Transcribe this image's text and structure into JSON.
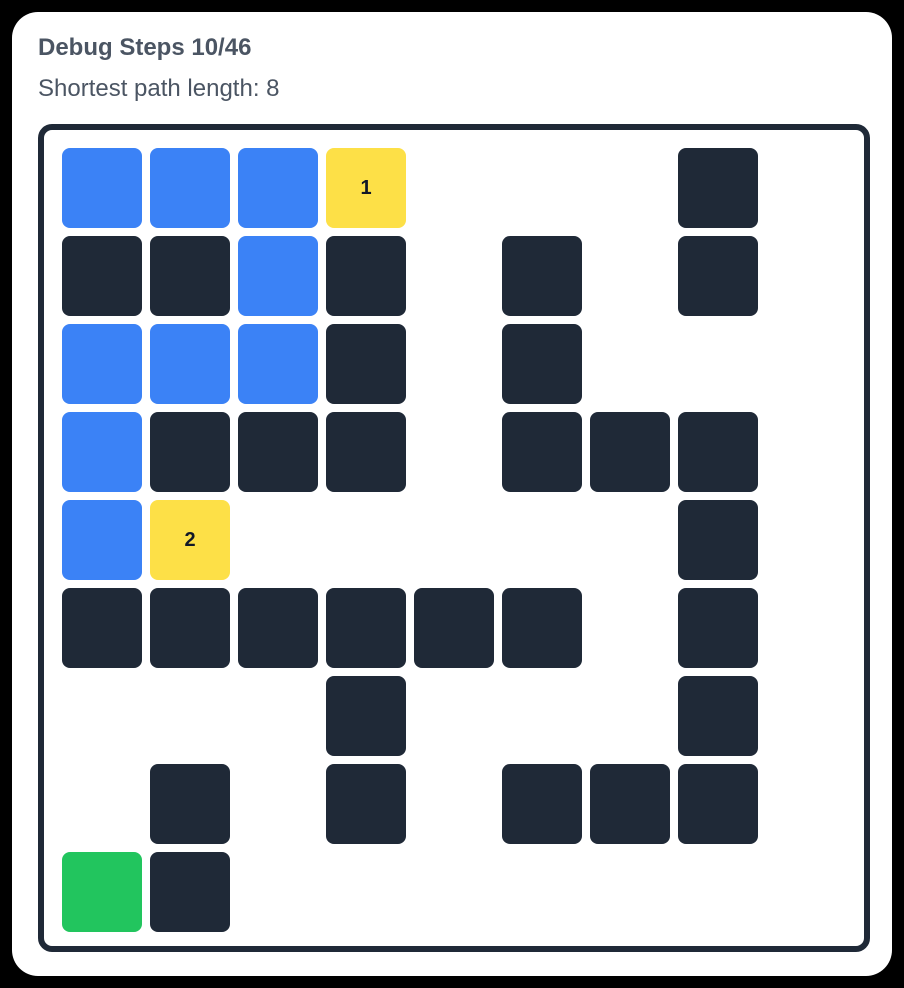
{
  "header": {
    "title": "Debug Steps 10/46",
    "subtitle": "Shortest path length: 8"
  },
  "colors": {
    "wall": "#1f2937",
    "visited": "#3b82f6",
    "waypoint": "#fde047",
    "goal": "#22c55e",
    "empty": "#ffffff",
    "border": "#1f2937"
  },
  "grid": {
    "rows": 9,
    "cols": 9,
    "legend": {
      "W": "wall",
      "V": "visited",
      "G": "goal",
      "Y": "waypoint",
      ".": "empty"
    },
    "cells": [
      [
        "V",
        "V",
        "V",
        "Y",
        ".",
        ".",
        ".",
        "W",
        "."
      ],
      [
        "W",
        "W",
        "V",
        "W",
        ".",
        "W",
        ".",
        "W",
        "."
      ],
      [
        "V",
        "V",
        "V",
        "W",
        ".",
        "W",
        ".",
        ".",
        "."
      ],
      [
        "V",
        "W",
        "W",
        "W",
        ".",
        "W",
        "W",
        "W",
        "."
      ],
      [
        "V",
        "Y",
        ".",
        ".",
        ".",
        ".",
        ".",
        "W",
        "."
      ],
      [
        "W",
        "W",
        "W",
        "W",
        "W",
        "W",
        ".",
        "W",
        "."
      ],
      [
        ".",
        ".",
        ".",
        "W",
        ".",
        ".",
        ".",
        "W",
        "."
      ],
      [
        ".",
        "W",
        ".",
        "W",
        ".",
        "W",
        "W",
        "W",
        "."
      ],
      [
        "G",
        "W",
        ".",
        ".",
        ".",
        ".",
        ".",
        ".",
        "."
      ]
    ],
    "waypoints": [
      {
        "row": 0,
        "col": 3,
        "label": "1"
      },
      {
        "row": 4,
        "col": 1,
        "label": "2"
      }
    ]
  }
}
